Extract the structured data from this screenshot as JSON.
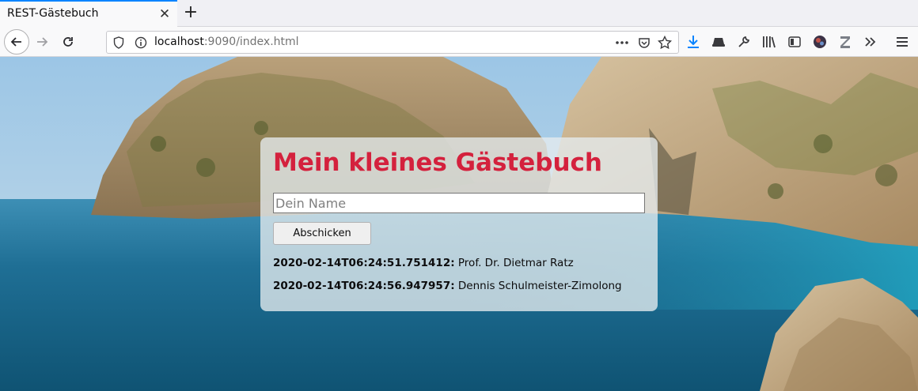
{
  "browser": {
    "tab": {
      "title": "REST-Gästebuch",
      "close_glyph": "✕"
    },
    "new_tab_glyph": "+",
    "url": {
      "host": "localhost",
      "rest": ":9090/index.html"
    },
    "icons": [
      "back-icon",
      "forward-icon",
      "reload-icon",
      "shield-icon",
      "info-icon",
      "more-icon",
      "pocket-icon",
      "bookmark-star-icon",
      "download-icon",
      "screenshot-icon",
      "wrench-icon",
      "library-icon",
      "sidebar-icon",
      "avatar-icon",
      "zotero-icon",
      "overflow-icon",
      "menu-icon"
    ],
    "accent": "#0a84ff"
  },
  "page": {
    "heading": "Mein kleines Gästebuch",
    "heading_color": "#d4213d",
    "name_placeholder": "Dein Name",
    "submit_label": "Abschicken",
    "entries": [
      {
        "timestamp": "2020-02-14T06:24:51.751412:",
        "name": " Prof. Dr. Dietmar Ratz"
      },
      {
        "timestamp": "2020-02-14T06:24:56.947957:",
        "name": " Dennis Schulmeister-Zimolong"
      }
    ]
  }
}
